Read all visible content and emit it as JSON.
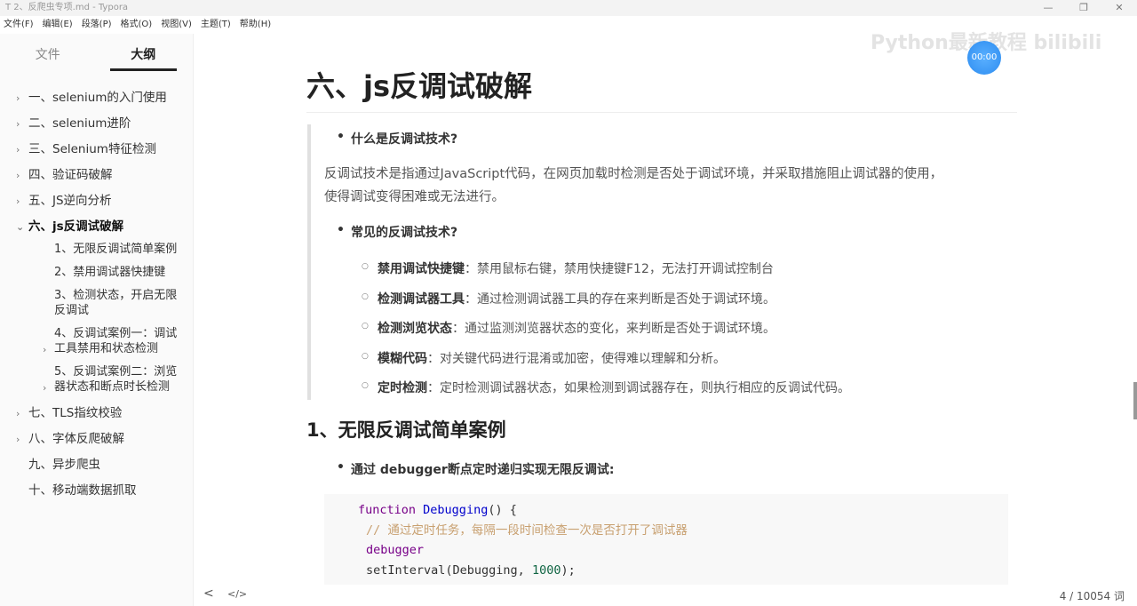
{
  "window": {
    "title": "T  2、反爬虫专项.md - Typora",
    "min": "—",
    "max": "❐",
    "close": "✕"
  },
  "menu": [
    "文件(F)",
    "编辑(E)",
    "段落(P)",
    "格式(O)",
    "视图(V)",
    "主题(T)",
    "帮助(H)"
  ],
  "sidebar": {
    "tabs": [
      "文件",
      "大纲"
    ],
    "items": [
      {
        "chev": "›",
        "label": "一、selenium的入门使用"
      },
      {
        "chev": "›",
        "label": "二、selenium进阶"
      },
      {
        "chev": "›",
        "label": "三、Selenium特征检测"
      },
      {
        "chev": "›",
        "label": "四、验证码破解"
      },
      {
        "chev": "›",
        "label": "五、JS逆向分析"
      },
      {
        "chev": "⌄",
        "label": "六、js反调试破解"
      }
    ],
    "subitems": [
      {
        "label": "1、无限反调试简单案例"
      },
      {
        "label": "2、禁用调试器快捷键"
      },
      {
        "label": "3、检测状态，开启无限反调试"
      },
      {
        "label": "4、反调试案例一：调试工具禁用和状态检测",
        "chev": "›"
      },
      {
        "label": "5、反调试案例二：浏览器状态和断点时长检测",
        "chev": "›"
      }
    ],
    "items2": [
      {
        "chev": "›",
        "label": "七、TLS指纹校验"
      },
      {
        "chev": "›",
        "label": "八、字体反爬破解"
      },
      {
        "chev": "",
        "label": "九、异步爬虫"
      },
      {
        "chev": "",
        "label": "十、移动端数据抓取"
      }
    ]
  },
  "main": {
    "h1": "六、js反调试破解",
    "q1": "什么是反调试技术?",
    "p1a": "反调试技术是指通过JavaScript代码，在网页加载时检测是否处于调试环境，并采取措施阻止调试器的使用，",
    "p1b": "使得调试变得困难或无法进行。",
    "q2": "常见的反调试技术?",
    "list": [
      {
        "b": "禁用调试快捷键",
        "t": "：禁用鼠标右键，禁用快捷键F12，无法打开调试控制台"
      },
      {
        "b": "检测调试器工具",
        "t": "：通过检测调试器工具的存在来判断是否处于调试环境。"
      },
      {
        "b": "检测浏览状态",
        "t": "：通过监测浏览器状态的变化，来判断是否处于调试环境。"
      },
      {
        "b": "模糊代码",
        "t": "：对关键代码进行混淆或加密，使得难以理解和分析。"
      },
      {
        "b": "定时检测",
        "t": "：定时检测调试器状态，如果检测到调试器存在，则执行相应的反调试代码。"
      }
    ],
    "h2": "1、无限反调试简单案例",
    "q3": "通过 debugger断点定时递归实现无限反调试:",
    "code": {
      "kw_function": "function",
      "fn_name": "Debugging",
      "paren": "() {",
      "comment": "// 通过定时任务，每隔一段时间检查一次是否打开了调试器",
      "debugger": "debugger",
      "set1": "setInterval(Debugging, ",
      "num": "1000",
      "set2": ");",
      "close": "}"
    }
  },
  "status": {
    "back": "<",
    "source": "</>",
    "words": "4 / 10054 词"
  },
  "overlay": {
    "watermark": "Python最新教程 bilibili",
    "timer": "00:00"
  }
}
